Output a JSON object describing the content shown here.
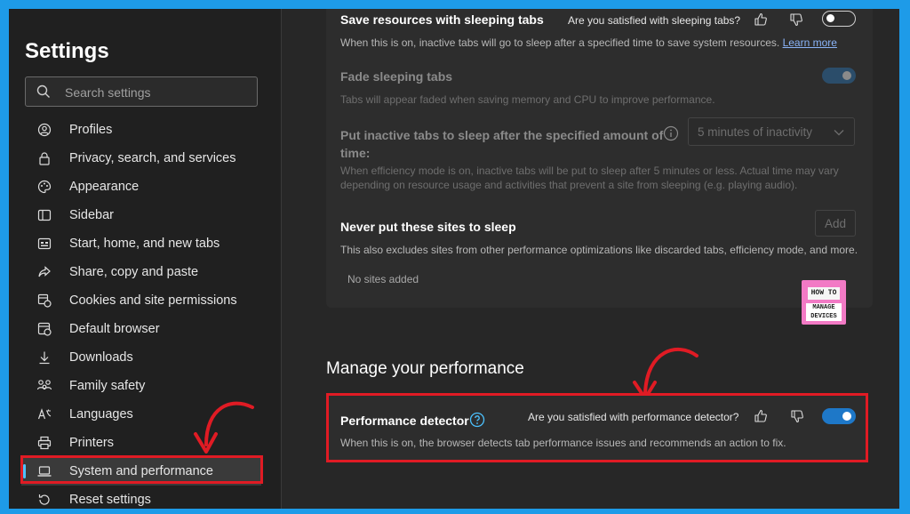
{
  "sidebar": {
    "title": "Settings",
    "search_placeholder": "Search settings",
    "items": [
      {
        "label": "Profiles",
        "icon": "profile-icon"
      },
      {
        "label": "Privacy, search, and services",
        "icon": "lock-icon"
      },
      {
        "label": "Appearance",
        "icon": "palette-icon"
      },
      {
        "label": "Sidebar",
        "icon": "sidebar-icon"
      },
      {
        "label": "Start, home, and new tabs",
        "icon": "home-tabs-icon"
      },
      {
        "label": "Share, copy and paste",
        "icon": "share-icon"
      },
      {
        "label": "Cookies and site permissions",
        "icon": "cookies-icon"
      },
      {
        "label": "Default browser",
        "icon": "browser-icon"
      },
      {
        "label": "Downloads",
        "icon": "download-icon"
      },
      {
        "label": "Family safety",
        "icon": "family-icon"
      },
      {
        "label": "Languages",
        "icon": "languages-icon"
      },
      {
        "label": "Printers",
        "icon": "printer-icon"
      },
      {
        "label": "System and performance",
        "icon": "laptop-icon",
        "active": true
      },
      {
        "label": "Reset settings",
        "icon": "reset-icon"
      }
    ]
  },
  "sleeping_tabs": {
    "title": "Save resources with sleeping tabs",
    "feedback": "Are you satisfied with sleeping tabs?",
    "description": "When this is on, inactive tabs will go to sleep after a specified time to save system resources.",
    "link": "Learn more",
    "enabled": false
  },
  "fade_tabs": {
    "title": "Fade sleeping tabs",
    "description": "Tabs will appear faded when saving memory and CPU to improve performance.",
    "enabled": true
  },
  "inactive_tabs": {
    "title_line1": "Put inactive tabs to sleep after the specified amount of",
    "title_line2": "time:",
    "description_line1": "When efficiency mode is on, inactive tabs will be put to sleep after 5 minutes or less. Actual time may vary",
    "description_line2": "depending on resource usage and activities that prevent a site from sleeping (e.g. playing audio).",
    "selected": "5 minutes of inactivity"
  },
  "never_sleep": {
    "title": "Never put these sites to sleep",
    "description": "This also excludes sites from other performance optimizations like discarded tabs, efficiency mode, and more.",
    "add_label": "Add",
    "empty_text": "No sites added"
  },
  "logo": {
    "top": "HOW TO",
    "bottom_line1": "MANAGE",
    "bottom_line2": "DEVICES"
  },
  "performance": {
    "section_title": "Manage your performance",
    "title": "Performance detector",
    "feedback": "Are you satisfied with performance detector?",
    "description": "When this is on, the browser detects tab performance issues and recommends an action to fix.",
    "enabled": true
  },
  "colors": {
    "accent": "#1e78c8",
    "highlight": "#e01b24",
    "page_border": "#1e9be8"
  }
}
